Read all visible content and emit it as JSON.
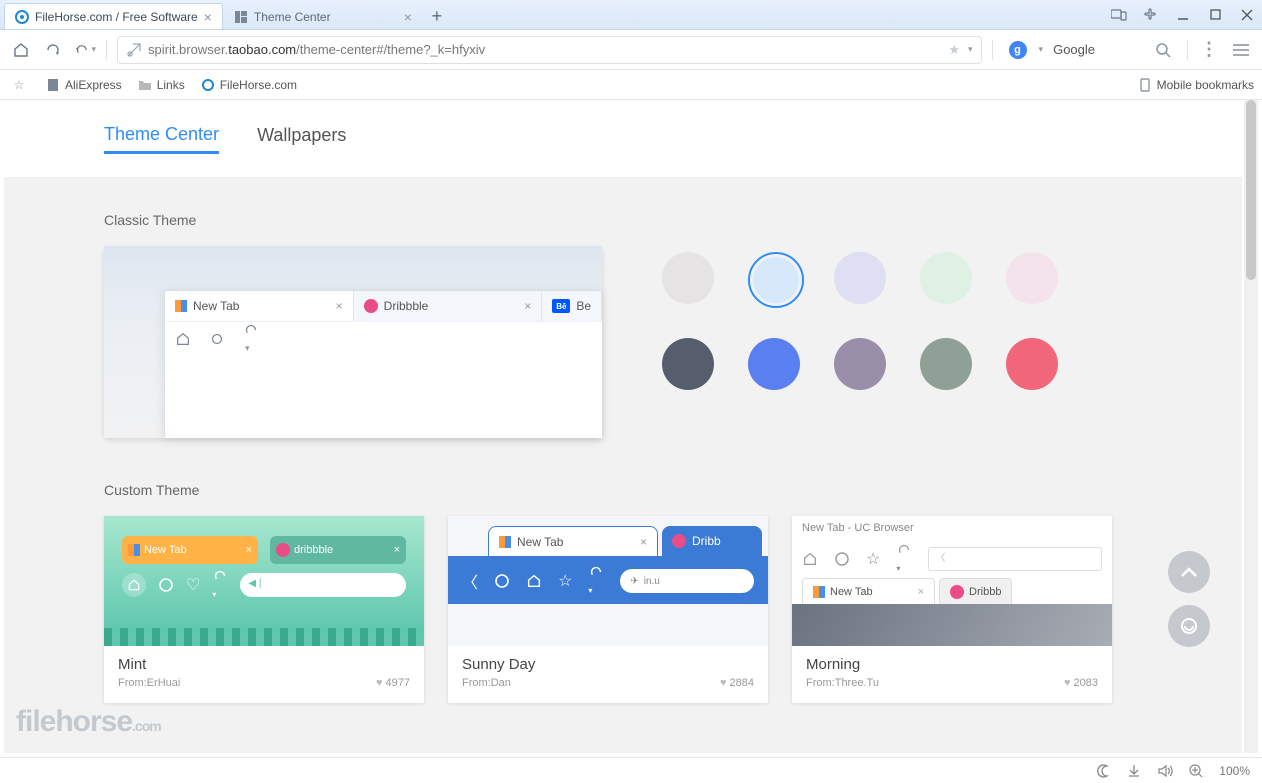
{
  "browser": {
    "tabs": [
      {
        "label": "FileHorse.com / Free Software",
        "favicon": "filehorse",
        "active": true
      },
      {
        "label": "Theme Center",
        "favicon": "theme",
        "active": false
      }
    ],
    "url_prefix": "spirit.browser.",
    "url_host": "taobao.com",
    "url_path": "/theme-center#/theme?_k=hfyxiv",
    "search_engine": "Google",
    "bookmarks": [
      {
        "label": "AliExpress",
        "icon": "page"
      },
      {
        "label": "Links",
        "icon": "folder"
      },
      {
        "label": "FileHorse.com",
        "icon": "filehorse"
      }
    ],
    "mobile_bookmarks": "Mobile bookmarks"
  },
  "page": {
    "nav": {
      "theme_center": "Theme Center",
      "wallpapers": "Wallpapers"
    },
    "classic": {
      "title": "Classic Theme",
      "preview_tabs": {
        "newtab": "New Tab",
        "dribbble": "Dribbble",
        "behance": "Be"
      },
      "swatches": [
        {
          "color": "#e6e3e5",
          "selected": false
        },
        {
          "color": "#d5e9fb",
          "selected": true
        },
        {
          "color": "#dedff2",
          "selected": false
        },
        {
          "color": "#dff1e4",
          "selected": false
        },
        {
          "color": "#f4e3ea",
          "selected": false
        },
        {
          "color": "#565e6e",
          "selected": false
        },
        {
          "color": "#5a7ff0",
          "selected": false
        },
        {
          "color": "#9a8fa9",
          "selected": false
        },
        {
          "color": "#8fa097",
          "selected": false
        },
        {
          "color": "#f2667a",
          "selected": false
        }
      ]
    },
    "custom": {
      "title": "Custom Theme",
      "themes": [
        {
          "name": "Mint",
          "from": "From:ErHuai",
          "likes": "4977",
          "newtab": "New Tab",
          "dribbble": "dribbble"
        },
        {
          "name": "Sunny Day",
          "from": "From:Dan",
          "likes": "2884",
          "newtab": "New Tab",
          "dribbble": "Dribb",
          "url": "in.u"
        },
        {
          "name": "Morning",
          "from": "From:Three.Tu",
          "likes": "2083",
          "title": "New Tab - UC Browser",
          "newtab": "New Tab",
          "dribbble": "Dribbb"
        }
      ]
    }
  },
  "status": {
    "zoom": "100%"
  },
  "watermark": {
    "main": "filehorse",
    "suffix": ".com"
  }
}
